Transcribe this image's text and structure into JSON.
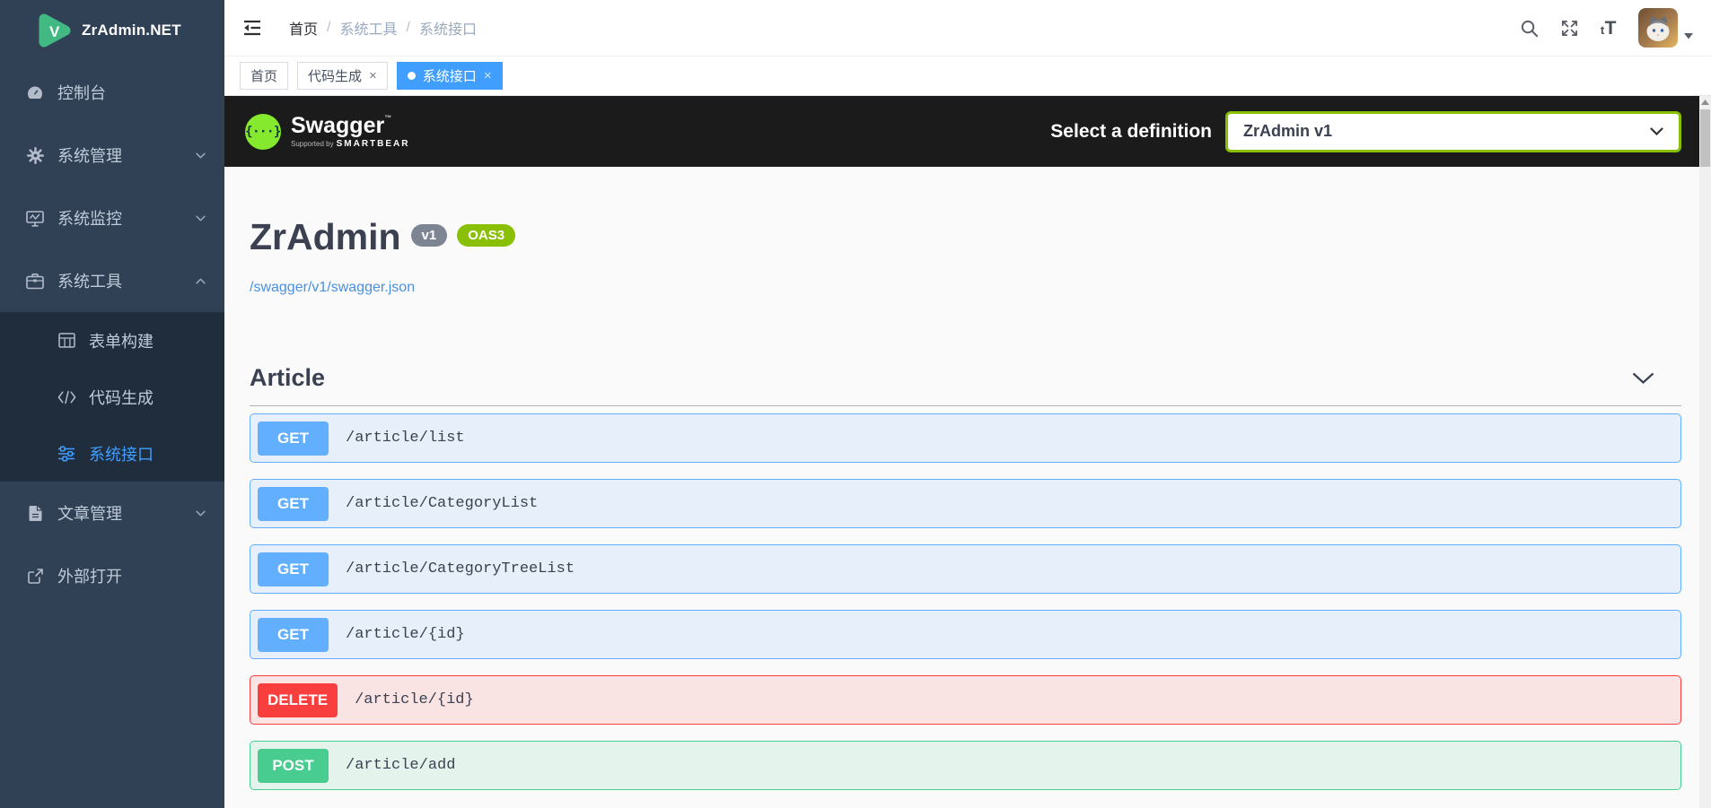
{
  "app": {
    "title": "ZrAdmin.NET"
  },
  "colors": {
    "accent": "#409eff",
    "sidebar_bg": "#304156",
    "submenu_bg": "#1f2d3d",
    "sidebar_text": "#bfcbd9",
    "swagger_bar_bg": "#1b1b1b",
    "swagger_green": "#85ea2d",
    "select_border": "#89bf04",
    "content_bg": "#fafafa",
    "heading": "#3b4151",
    "link": "#4990e2",
    "version_badge_bg": "#7d8492",
    "oas_badge_bg": "#89bf04"
  },
  "sidebar": {
    "items": [
      {
        "id": "console",
        "label": "控制台",
        "icon": "dashboard-icon",
        "expandable": false
      },
      {
        "id": "system-management",
        "label": "系统管理",
        "icon": "gear-icon",
        "expandable": true,
        "expanded": false
      },
      {
        "id": "system-monitor",
        "label": "系统监控",
        "icon": "monitor-icon",
        "expandable": true,
        "expanded": false
      },
      {
        "id": "system-tools",
        "label": "系统工具",
        "icon": "toolbox-icon",
        "expandable": true,
        "expanded": true,
        "children": [
          {
            "id": "form-builder",
            "label": "表单构建",
            "icon": "table-icon"
          },
          {
            "id": "code-generator",
            "label": "代码生成",
            "icon": "code-icon"
          },
          {
            "id": "system-api",
            "label": "系统接口",
            "icon": "sliders-icon",
            "active": true
          }
        ]
      },
      {
        "id": "article-management",
        "label": "文章管理",
        "icon": "document-icon",
        "expandable": true,
        "expanded": false
      },
      {
        "id": "external-open",
        "label": "外部打开",
        "icon": "external-link-icon",
        "expandable": false
      }
    ]
  },
  "topbar": {
    "breadcrumb": [
      "首页",
      "系统工具",
      "系统接口"
    ],
    "separator": "/",
    "textsize_glyph": "tT"
  },
  "tabs": [
    {
      "id": "home",
      "label": "首页",
      "closable": false,
      "active": false
    },
    {
      "id": "code-generator",
      "label": "代码生成",
      "closable": true,
      "active": false
    },
    {
      "id": "system-api",
      "label": "系统接口",
      "closable": true,
      "active": true
    }
  ],
  "swagger": {
    "topbar": {
      "logo_glyph": "{···}",
      "logo_text": "Swagger",
      "logo_tm": "™",
      "supported_by": "Supported by",
      "brand": "SMARTBEAR",
      "select_label": "Select a definition",
      "select_value": "ZrAdmin v1"
    },
    "info": {
      "title": "ZrAdmin",
      "version": "v1",
      "oas": "OAS3",
      "spec_url": "/swagger/v1/swagger.json"
    },
    "section": {
      "title": "Article"
    },
    "endpoints": [
      {
        "method": "GET",
        "path": "/article/list"
      },
      {
        "method": "GET",
        "path": "/article/CategoryList"
      },
      {
        "method": "GET",
        "path": "/article/CategoryTreeList"
      },
      {
        "method": "GET",
        "path": "/article/{id}"
      },
      {
        "method": "DELETE",
        "path": "/article/{id}"
      },
      {
        "method": "POST",
        "path": "/article/add"
      }
    ],
    "method_colors": {
      "GET": {
        "badge": "#61affe",
        "border": "#61affe",
        "bg": "rgba(97,175,254,0.12)"
      },
      "DELETE": {
        "badge": "#f93e3e",
        "border": "#f93e3e",
        "bg": "rgba(249,62,62,0.12)"
      },
      "POST": {
        "badge": "#49cc90",
        "border": "#49cc90",
        "bg": "rgba(73,204,144,0.12)"
      }
    }
  }
}
